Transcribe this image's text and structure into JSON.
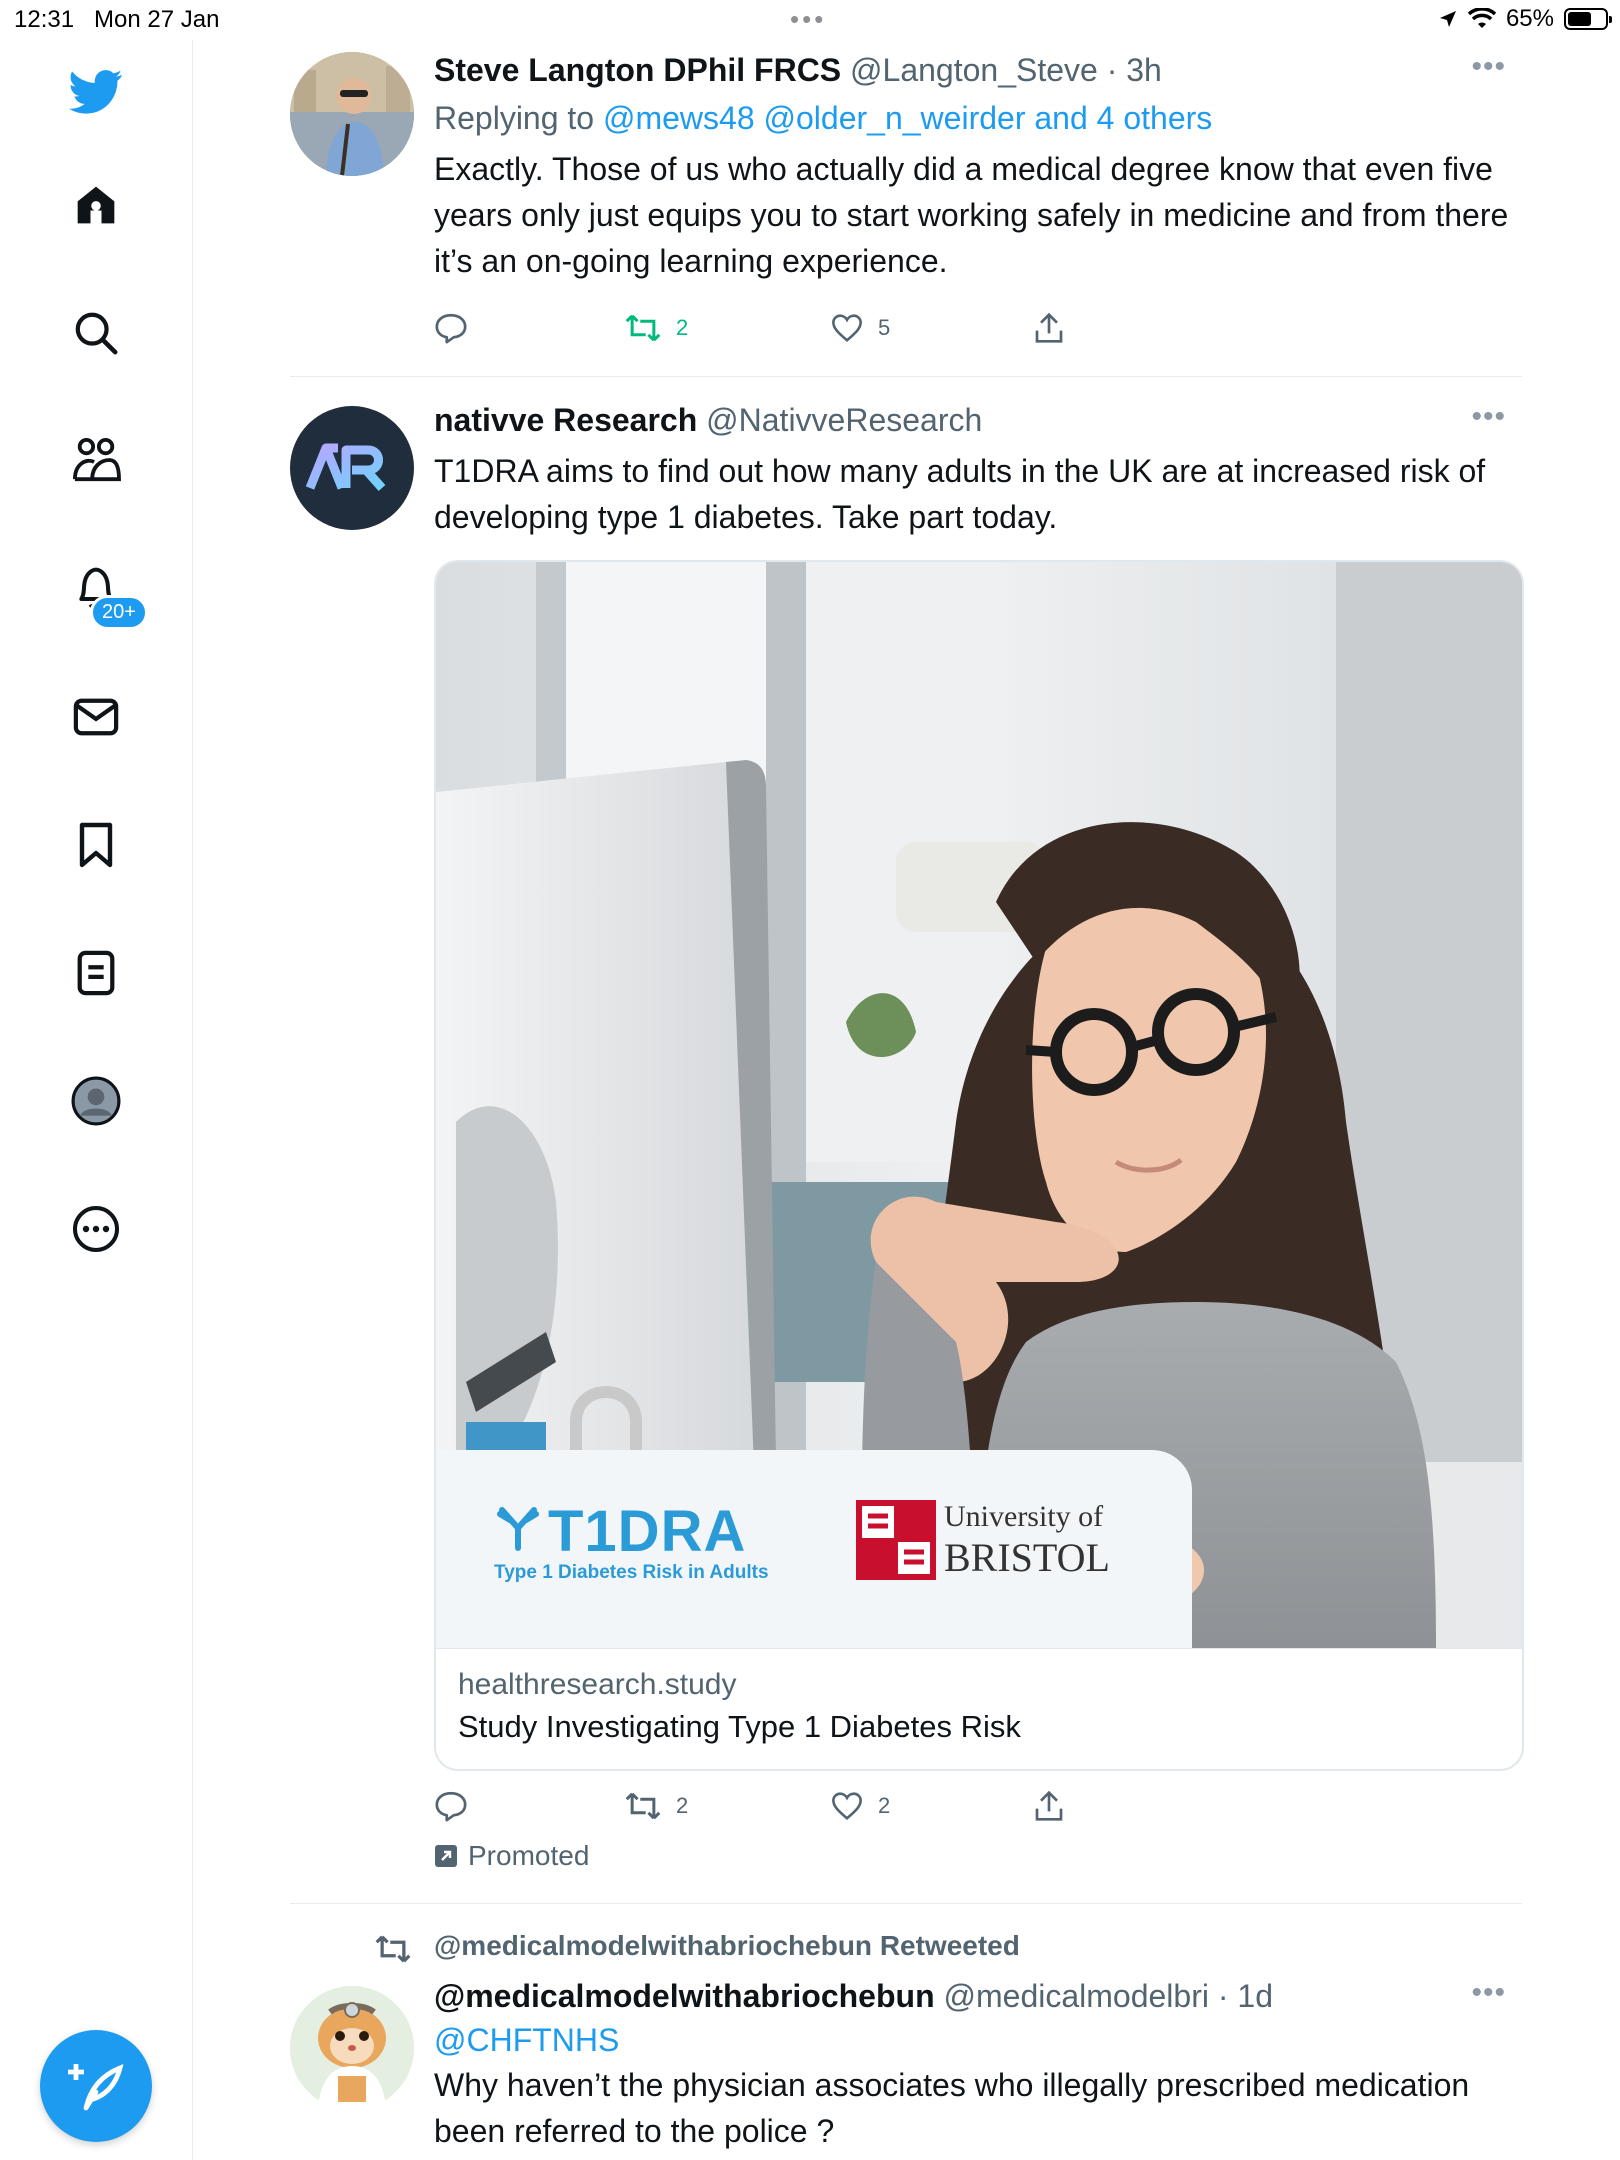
{
  "status_bar": {
    "time": "12:31",
    "date": "Mon 27 Jan",
    "battery": "65%",
    "battery_level": 0.65
  },
  "sidebar": {
    "items": [
      {
        "name": "twitter-logo-icon"
      },
      {
        "name": "home-icon"
      },
      {
        "name": "search-icon"
      },
      {
        "name": "communities-icon"
      },
      {
        "name": "notifications-icon"
      },
      {
        "name": "messages-icon"
      },
      {
        "name": "bookmarks-icon"
      },
      {
        "name": "lists-icon"
      },
      {
        "name": "profile-icon"
      },
      {
        "name": "more-icon"
      }
    ],
    "notifications_badge": "20+",
    "accent": "#1d9bf0"
  },
  "tweets": [
    {
      "name": "Steve Langton DPhil FRCS",
      "handle": "@Langton_Steve · 3h",
      "replying_prefix": "Replying to ",
      "replying_mentions": "@mews48 @older_n_weirder and 4 others",
      "text": "Exactly. Those of us who actually did a medical degree know that even five years only just equips you to start working safely in medicine and from there it’s an on-going learning experience.",
      "retweets": "2",
      "likes": "5"
    },
    {
      "name": "nativve Research",
      "handle": "@NativveResearch",
      "text": "T1DRA aims to find out how many adults in the UK are at increased risk of developing type 1 diabetes. Take part today.",
      "card": {
        "t1dra_logo": "T1DRA",
        "t1dra_tagline": "Type 1 Diabetes Risk in Adults",
        "university_line1": "University of",
        "university_line2": "BRISTOL",
        "domain": "healthresearch.study",
        "title": "Study Investigating Type 1 Diabetes Risk"
      },
      "retweets": "2",
      "likes": "2",
      "promoted": "Promoted"
    },
    {
      "retweeted_by": "@medicalmodelwithabriochebun Retweeted",
      "name": "@medicalmodelwithabriochebun",
      "handle": "@medicalmodelbri · 1d",
      "mention": "@CHFTNHS",
      "text": "Why haven’t the physician associates who illegally prescribed medication been referred to the police ?"
    }
  ],
  "colors": {
    "accent": "#1d9bf0",
    "retweet_active": "#00ba7c",
    "text_secondary": "#536471"
  }
}
